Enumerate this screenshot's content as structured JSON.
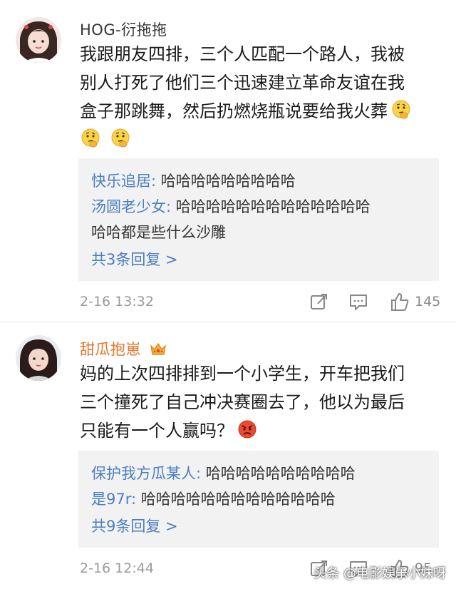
{
  "comments": [
    {
      "username": "HOG-衍拖拖",
      "username_color": "#333333",
      "text_lines": [
        "我跟朋友四排，三个人匹配一个路人，我被",
        "别人打死了他们三个迅速建立革命友谊在我",
        "盒子那跳舞，然后扔燃烧瓶说要给我火葬"
      ],
      "emojis": [
        "thinking-face-emoji",
        "thinking-face-emoji",
        "thinking-face-emoji"
      ],
      "replies": [
        {
          "name": "快乐追居:",
          "text": " 哈哈哈哈哈哈哈哈哈"
        },
        {
          "name": "汤圆老少女:",
          "text": " 哈哈哈哈哈哈哈哈哈哈哈哈哈"
        },
        {
          "name": "",
          "text": "哈哈都是些什么沙雕"
        }
      ],
      "more_replies": "共3条回复 >",
      "timestamp": "2-16 13:32",
      "like_count": "145"
    },
    {
      "username": "甜瓜抱崽",
      "username_color": "#e8742a",
      "badge": "crown-badge-icon",
      "text_lines": [
        "妈的上次四排排到一个小学生，开车把我们",
        "三个撞死了自己冲决赛圈去了，他以为最后",
        "只能有一个人赢吗？"
      ],
      "emojis": [
        "angry-face-emoji"
      ],
      "replies": [
        {
          "name": "保护我方瓜某人:",
          "text": " 哈哈哈哈哈哈哈哈哈哈"
        },
        {
          "name": "是97r:",
          "text": " 哈哈哈哈哈哈哈哈哈哈哈哈哈"
        }
      ],
      "more_replies": "共9条回复 >",
      "timestamp": "2-16 12:44",
      "like_count": "95"
    }
  ],
  "watermark": "头条 @电影娱乐小妹呀"
}
